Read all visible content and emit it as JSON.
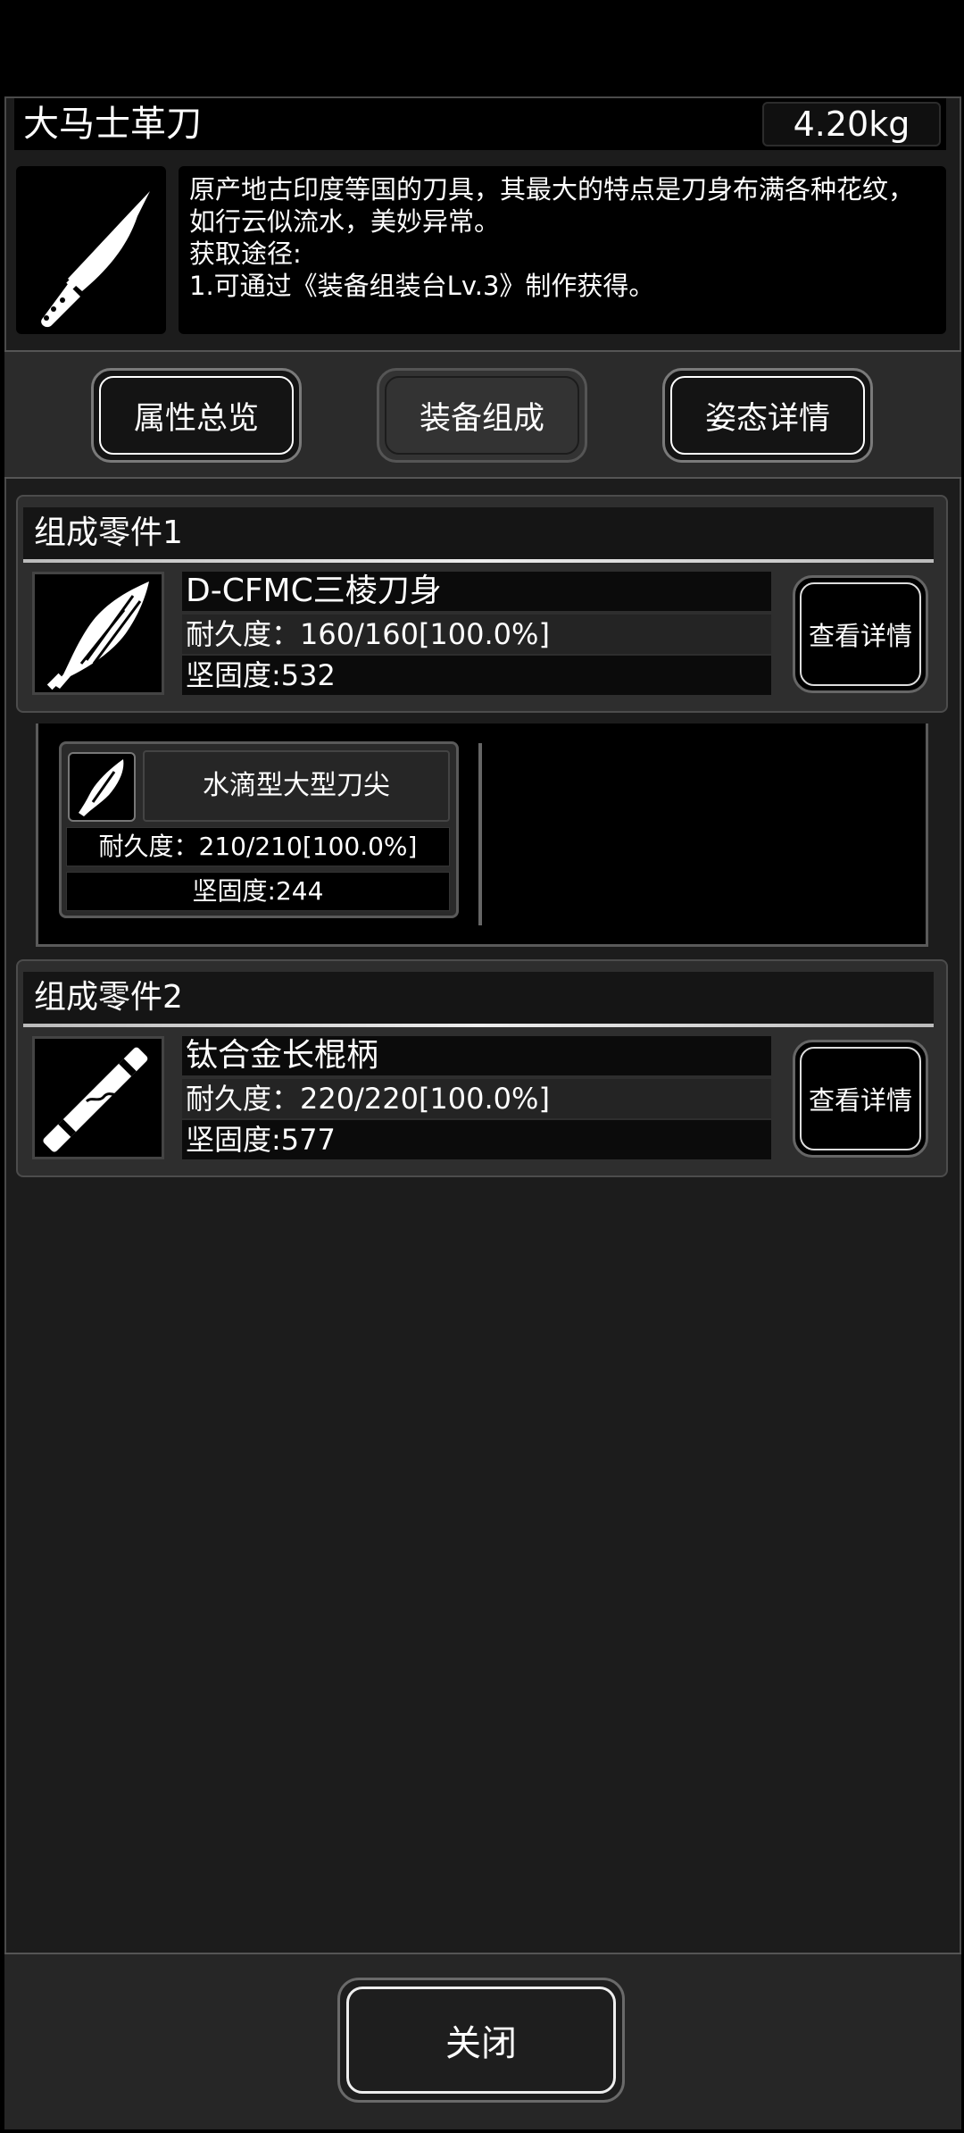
{
  "item": {
    "name": "大马士革刀",
    "weight": "4.20kg",
    "icon": "knife-icon",
    "description": "原产地古印度等国的刀具，其最大的特点是刀身布满各种花纹，\n如行云似流水，美妙异常。\n获取途径:\n1.可通过《装备组装台Lv.3》制作获得。"
  },
  "tabs": [
    {
      "label": "属性总览",
      "active": false
    },
    {
      "label": "装备组成",
      "active": true
    },
    {
      "label": "姿态详情",
      "active": false
    }
  ],
  "parts": [
    {
      "title": "组成零件1",
      "name": "D-CFMC三棱刀身",
      "durability": "耐久度：160/160[100.0%]",
      "hardness": "坚固度:532",
      "icon": "blade-icon",
      "detail_label": "查看详情",
      "sub_parts": [
        {
          "name": "水滴型大型刀尖",
          "durability": "耐久度：210/210[100.0%]",
          "hardness": "坚固度:244",
          "icon": "blade-tip-icon"
        }
      ]
    },
    {
      "title": "组成零件2",
      "name": "钛合金长棍柄",
      "durability": "耐久度：220/220[100.0%]",
      "hardness": "坚固度:577",
      "icon": "handle-icon",
      "detail_label": "查看详情"
    }
  ],
  "footer": {
    "close_label": "关闭"
  },
  "colors": {
    "panel": "#1c1c1c",
    "accent": "#ffffff",
    "background": "#000000"
  }
}
